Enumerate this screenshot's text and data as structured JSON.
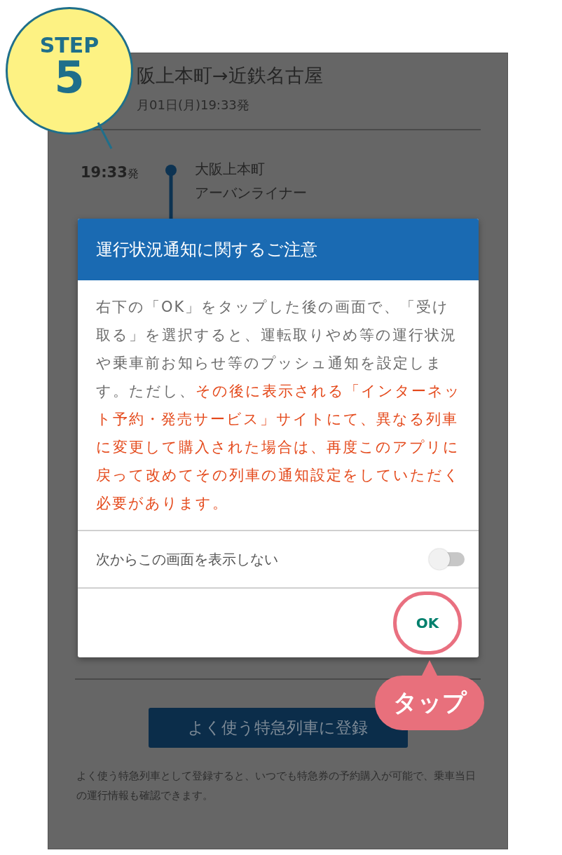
{
  "step_badge": {
    "label": "STEP",
    "number": "5"
  },
  "screen": {
    "route_title": "阪上本町→近鉄名古屋",
    "departure": "月01日(月)19:33発",
    "timeline": [
      {
        "time": "19:33",
        "suffix": "発",
        "station": "大阪上本町",
        "train": "アーバンライナー"
      }
    ],
    "register_button": "よく使う特急列車に登録",
    "register_note": "よく使う特急列車として登録すると、いつでも特急券の予約購入が可能で、乗車当日の運行情報も確認できます。"
  },
  "dialog": {
    "title": "運行状況通知に関するご注意",
    "message": [
      {
        "kind": "normal",
        "text": "右下の「OK」をタップした後の画面で、「受け取る」を選択すると、運転取りやめ等の運行状況や乗車前お知らせ等のプッシュ通知を設定します。ただし、"
      },
      {
        "kind": "warning",
        "text": "その後に表示される「インターネット予約・発売サービス」サイトにて、異なる列車に変更して購入された場合は、再度このアプリに戻って改めてその列車の通知設定をしていただく必要があります。"
      }
    ],
    "toggle": {
      "label": "次からこの画面を表示しない",
      "on": false
    },
    "ok_button": "OK"
  },
  "callout": {
    "label": "タップ"
  }
}
